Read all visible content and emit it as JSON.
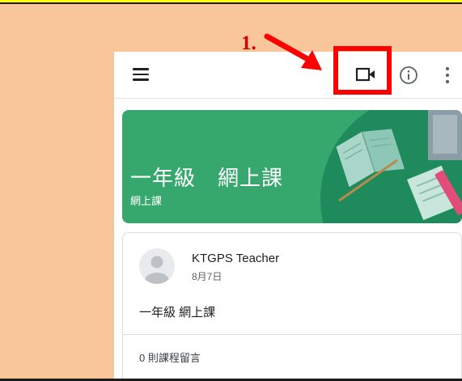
{
  "annotation": {
    "step_label": "1."
  },
  "appbar": {
    "menu_icon": "menu-icon",
    "video_icon": "video-camera-icon",
    "info_icon": "info-icon",
    "more_icon": "more-vert-icon"
  },
  "banner": {
    "title": "一年級　網上課",
    "subtitle": "網上課",
    "color": "#37a86d"
  },
  "post": {
    "author": "KTGPS Teacher",
    "date": "8月7日",
    "body": "一年級 網上課",
    "comments": "0 則課程留言"
  },
  "colors": {
    "background": "#f9c59a",
    "highlight": "#ff0000",
    "accent": "#37a86d"
  }
}
